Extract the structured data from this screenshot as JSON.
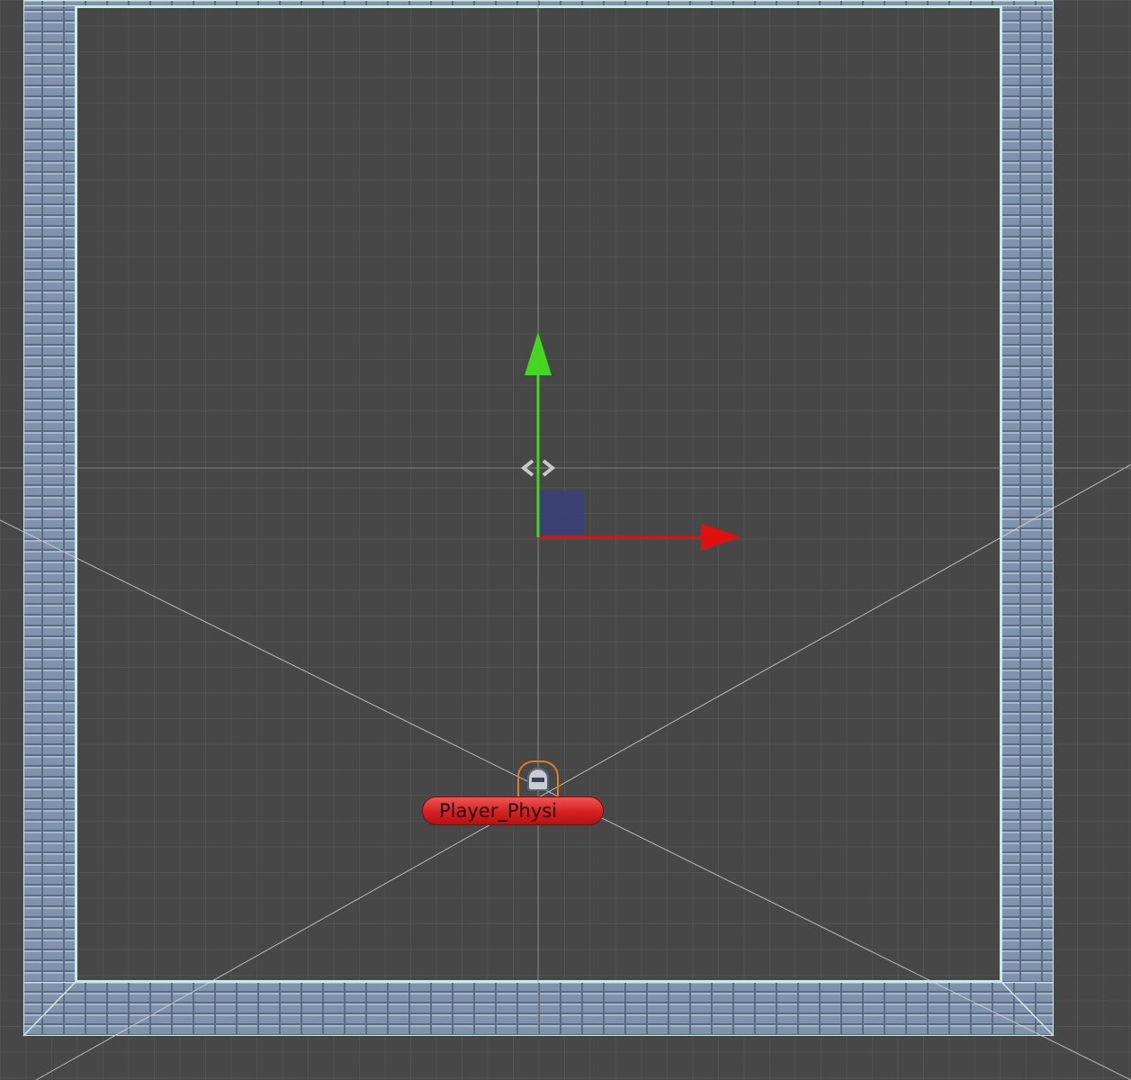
{
  "scene": {
    "background": "#474747",
    "wall_color": "#7f93ad",
    "collider_outline_color": "#bfeeea"
  },
  "gizmo": {
    "x_axis_color": "#e01010",
    "y_axis_color": "#44d620",
    "plane_handle_color": "#3a3f7a",
    "pivot_icon": "diamond-pivot-icon"
  },
  "player": {
    "icon": "knight-helmet-icon",
    "selection_color": "#e07d2c",
    "name_label": "Player_Physi"
  }
}
